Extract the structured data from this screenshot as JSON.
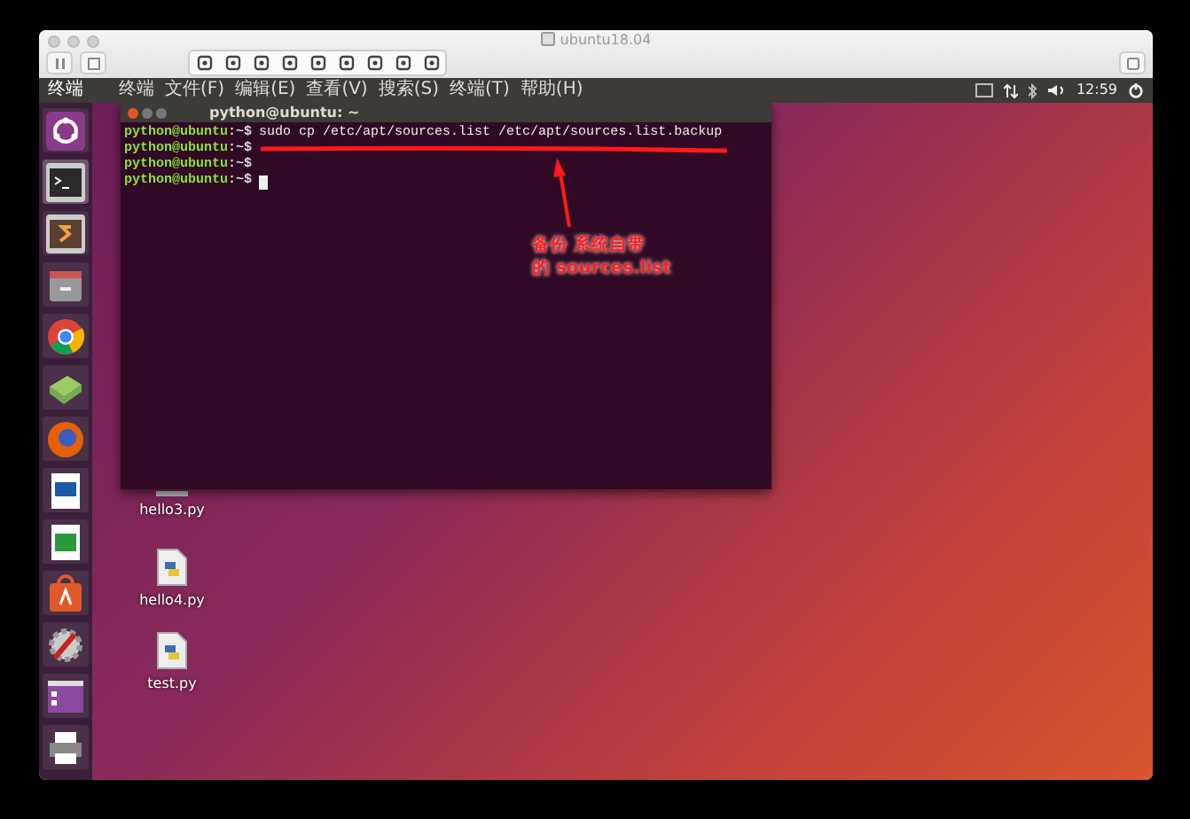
{
  "window": {
    "title": "ubuntu18.04"
  },
  "top_panel": {
    "app_name": "终端",
    "menus": [
      "终端",
      "文件(F)",
      "编辑(E)",
      "查看(V)",
      "搜索(S)",
      "终端(T)",
      "帮助(H)"
    ],
    "clock": "12:59"
  },
  "terminal": {
    "title": "python@ubuntu: ~",
    "lines": [
      {
        "user_host": "python@ubuntu",
        "path": ":~$",
        "command": "sudo cp /etc/apt/sources.list /etc/apt/sources.list.backup",
        "cursor": false
      },
      {
        "user_host": "python@ubuntu",
        "path": ":~$",
        "cursor": false
      },
      {
        "user_host": "python@ubuntu",
        "path": ":~$",
        "cursor": false
      },
      {
        "user_host": "python@ubuntu",
        "path": ":~$",
        "cursor": true
      }
    ]
  },
  "desktop_icons": [
    {
      "label": "hello3.py",
      "kind": "blank"
    },
    {
      "label": "hello4.py",
      "kind": "python"
    },
    {
      "label": "test.py",
      "kind": "python"
    }
  ],
  "annotation": {
    "lines": [
      "备份 系统自带",
      "的 sources.list"
    ]
  }
}
